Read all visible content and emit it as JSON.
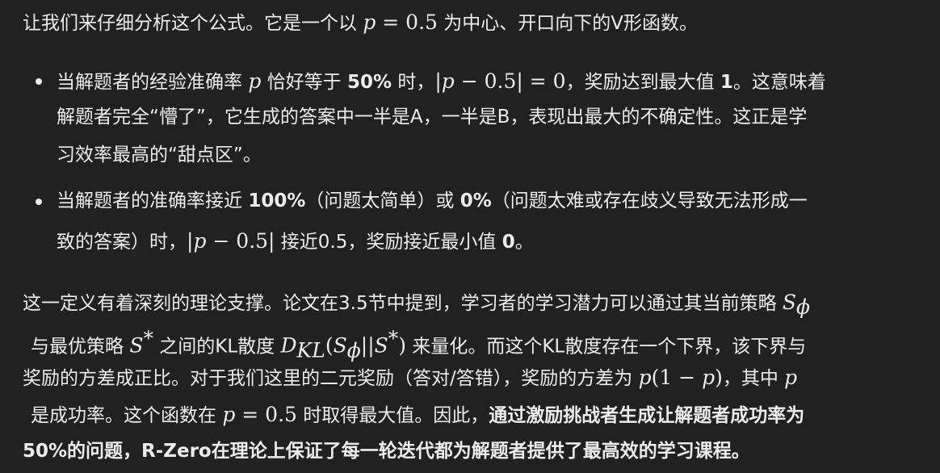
{
  "intro": {
    "pre": "让我们来仔细分析这个公式。它是一个以 ",
    "mvar": "p",
    "mrest": " = 0.5",
    "post": " 为中心、开口向下的V形函数。"
  },
  "bullet1": {
    "l1_a": "当解题者的经验准确率 ",
    "l1_p": "p",
    "l1_b": " 恰好等于 ",
    "l1_bold1": "50%",
    "l1_c": " 时，",
    "l1_m1": "|",
    "l1_m2": "p",
    "l1_m3": " − 0.5| = 0",
    "l1_d": "，奖励达到最大值 ",
    "l1_bold2": "1",
    "l1_e": "。这意味着",
    "l2": "解题者完全“懵了”，它生成的答案中一半是A，一半是B，表现出最大的不确定性。这正是学",
    "l3": "习效率最高的“甜点区”。"
  },
  "bullet2": {
    "l1_a": "当解题者的准确率接近 ",
    "l1_bold1": "100%",
    "l1_b": "（问题太简单）或 ",
    "l1_bold2": "0%",
    "l1_c": "（问题太难或存在歧义导致无法形成一",
    "l2_a": "致的答案）时，",
    "l2_m1": "|",
    "l2_m2": "p",
    "l2_m3": " − 0.5|",
    "l2_b": " 接近0.5，奖励接近最小值 ",
    "l2_bold": "0",
    "l2_c": "。"
  },
  "para2": {
    "l1_a": "这一定义有着深刻的理论支撑。论文在3.5节中提到，学习者的学习潜力可以通过其当前策略 ",
    "l1_S": "S",
    "l1_phi": "ϕ",
    "l2_a": "与最优策略 ",
    "l2_S": "S",
    "l2_star": "*",
    "l2_b": " 之间的KL散度 ",
    "l2_D": "D",
    "l2_KL": "KL",
    "l2_open": "(",
    "l2_S2": "S",
    "l2_phi2": "ϕ",
    "l2_bars": "||",
    "l2_S3": "S",
    "l2_star2": "*",
    "l2_close": ")",
    "l2_c": " 来量化。而这个KL散度存在一个下界，该下界与",
    "l3_a": "奖励的方差成正比。对于我们这里的二元奖励（答对/答错），奖励的方差为 ",
    "l3_p": "p",
    "l3_m": "(1 − ",
    "l3_p2": "p",
    "l3_close": ")",
    "l3_b": "，其中 ",
    "l3_p3": "p",
    "l4_a": "是成功率。这个函数在 ",
    "l4_p": "p",
    "l4_m": " = 0.5",
    "l4_b": " 时取得最大值。因此，",
    "l4_bold": "通过激励挑战者生成让解题者成功率为",
    "l5_bold": "50%的问题，R-Zero在理论上保证了每一轮迭代都为解题者提供了最高效的学习课程。"
  }
}
